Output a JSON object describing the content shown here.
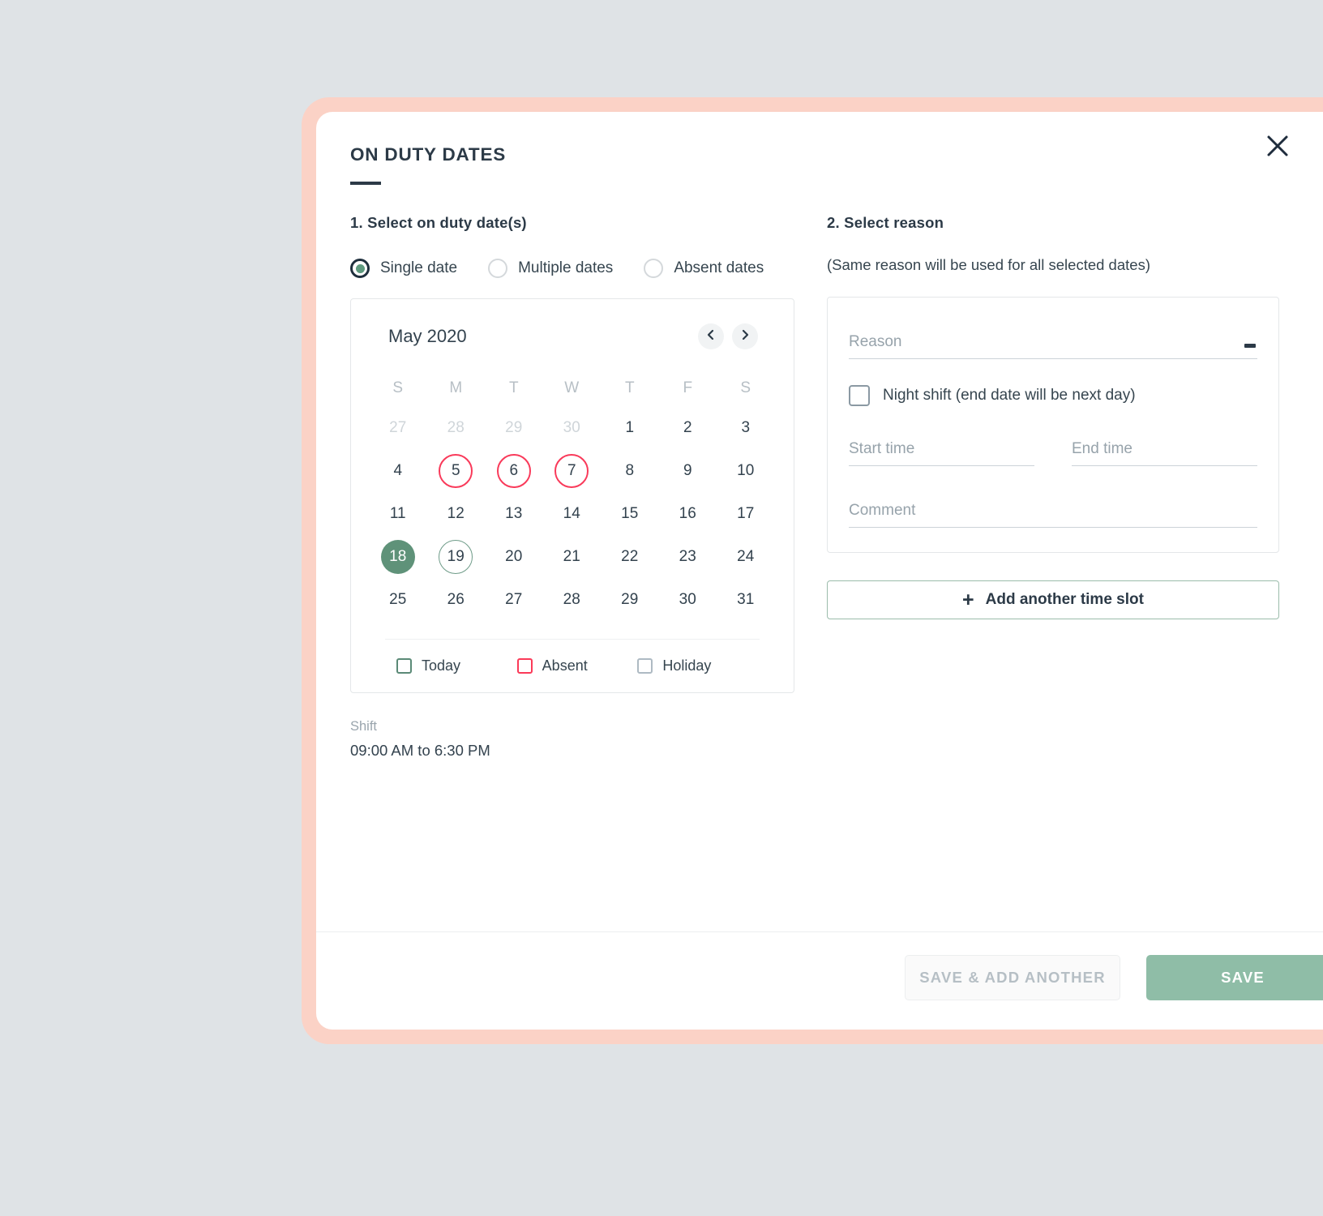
{
  "modal": {
    "title": "ON DUTY DATES",
    "close_icon": "close-icon",
    "accent_border_color": "#fbd2c6",
    "primary_color": "#5f9279"
  },
  "left": {
    "step_heading": "1. Select on duty date(s)",
    "radios": [
      {
        "label": "Single date",
        "selected": true
      },
      {
        "label": "Multiple dates",
        "selected": false
      },
      {
        "label": "Absent dates",
        "selected": false
      }
    ],
    "calendar": {
      "month_label": "May 2020",
      "prev_icon": "chevron-left-icon",
      "next_icon": "chevron-right-icon",
      "dow": [
        "S",
        "M",
        "T",
        "W",
        "T",
        "F",
        "S"
      ],
      "weeks": [
        [
          {
            "n": "27",
            "state": "muted"
          },
          {
            "n": "28",
            "state": "muted"
          },
          {
            "n": "29",
            "state": "muted"
          },
          {
            "n": "30",
            "state": "muted"
          },
          {
            "n": "1",
            "state": "normal"
          },
          {
            "n": "2",
            "state": "normal"
          },
          {
            "n": "3",
            "state": "normal"
          }
        ],
        [
          {
            "n": "4",
            "state": "normal"
          },
          {
            "n": "5",
            "state": "absent"
          },
          {
            "n": "6",
            "state": "absent"
          },
          {
            "n": "7",
            "state": "absent"
          },
          {
            "n": "8",
            "state": "normal"
          },
          {
            "n": "9",
            "state": "normal"
          },
          {
            "n": "10",
            "state": "normal"
          }
        ],
        [
          {
            "n": "11",
            "state": "normal"
          },
          {
            "n": "12",
            "state": "normal"
          },
          {
            "n": "13",
            "state": "normal"
          },
          {
            "n": "14",
            "state": "normal"
          },
          {
            "n": "15",
            "state": "normal"
          },
          {
            "n": "16",
            "state": "normal"
          },
          {
            "n": "17",
            "state": "normal"
          }
        ],
        [
          {
            "n": "18",
            "state": "selected"
          },
          {
            "n": "19",
            "state": "today"
          },
          {
            "n": "20",
            "state": "normal"
          },
          {
            "n": "21",
            "state": "normal"
          },
          {
            "n": "22",
            "state": "normal"
          },
          {
            "n": "23",
            "state": "normal"
          },
          {
            "n": "24",
            "state": "normal"
          }
        ],
        [
          {
            "n": "25",
            "state": "normal"
          },
          {
            "n": "26",
            "state": "normal"
          },
          {
            "n": "27",
            "state": "normal"
          },
          {
            "n": "28",
            "state": "normal"
          },
          {
            "n": "29",
            "state": "normal"
          },
          {
            "n": "30",
            "state": "normal"
          },
          {
            "n": "31",
            "state": "normal"
          }
        ]
      ],
      "legend": [
        {
          "label": "Today",
          "color": "#5b8a77"
        },
        {
          "label": "Absent",
          "color": "#fb3a58"
        },
        {
          "label": "Holiday",
          "color": "#aebac3"
        }
      ]
    },
    "shift": {
      "label": "Shift",
      "value": "09:00 AM to 6:30 PM"
    }
  },
  "right": {
    "step_heading": "2. Select reason",
    "hint": "(Same reason will be used for all selected dates)",
    "reason": {
      "placeholder": "Reason",
      "value": ""
    },
    "night_shift": {
      "label": "Night shift (end date will be next day)",
      "checked": false
    },
    "start_time": {
      "placeholder": "Start time",
      "value": ""
    },
    "end_time": {
      "placeholder": "End time",
      "value": ""
    },
    "comment": {
      "placeholder": "Comment",
      "value": ""
    },
    "add_slot": {
      "label": "Add another time slot",
      "icon": "plus-icon"
    }
  },
  "footer": {
    "save_and_add_another": "SAVE & ADD ANOTHER",
    "save": "SAVE"
  }
}
